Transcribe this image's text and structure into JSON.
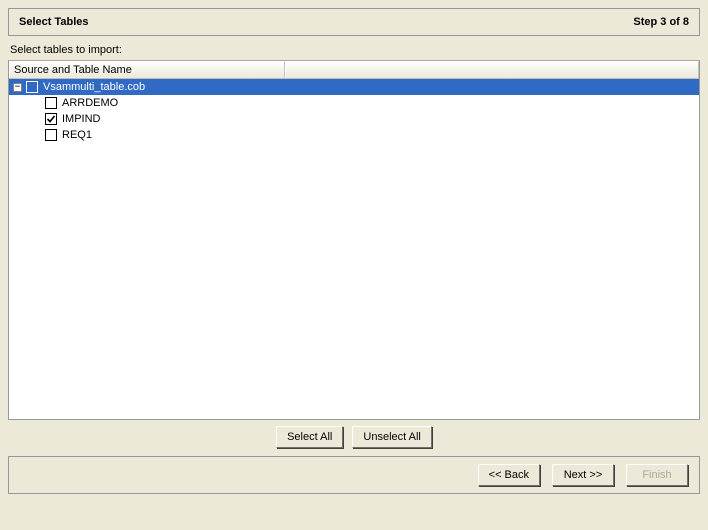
{
  "header": {
    "title": "Select Tables",
    "step": "Step 3 of 8"
  },
  "instruction": "Select tables to import:",
  "tree": {
    "column_header": "Source and Table Name",
    "root": {
      "label": "Vsammulti_table.cob",
      "expanded": true,
      "selected": true,
      "checked": false
    },
    "children": [
      {
        "label": "ARRDEMO",
        "checked": false
      },
      {
        "label": "IMPIND",
        "checked": true
      },
      {
        "label": "REQ1",
        "checked": false
      }
    ]
  },
  "buttons": {
    "select_all": "Select All",
    "unselect_all": "Unselect All",
    "back": "<< Back",
    "next": "Next >>",
    "finish": "Finish"
  }
}
